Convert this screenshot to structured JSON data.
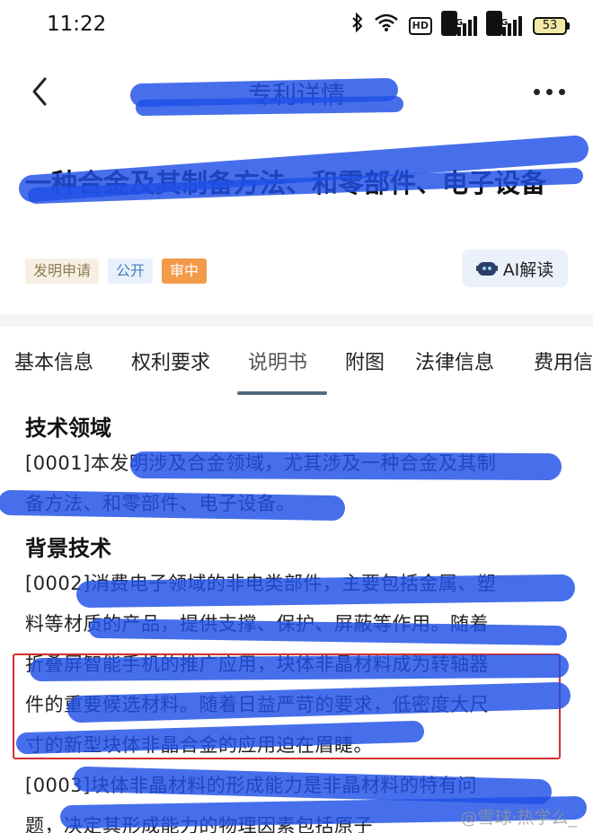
{
  "status_bar": {
    "time": "11:22",
    "network_1": "5G",
    "network_2": "4G",
    "hd": "HD",
    "battery": "53",
    "signal_levels": [
      4,
      4
    ]
  },
  "header": {
    "title": "专利详情"
  },
  "patent": {
    "title": "一种合金及其制备方法、和零部件、电子设备",
    "tags": [
      "发明申请",
      "公开",
      "审中"
    ],
    "ai_label": "AI解读"
  },
  "tabs": [
    "基本信息",
    "权利要求",
    "说明书",
    "附图",
    "法律信息",
    "费用信"
  ],
  "active_tab": 2,
  "content": {
    "heading_1": "技术领域",
    "para_1_lines": [
      "[0001]本发明涉及合金领域，尤其涉及一种合金及其制",
      "备方法、和零部件、电子设备。"
    ],
    "heading_2": "背景技术",
    "para_2_lines": [
      "[0002]消费电子领域的非电类部件，主要包括金属、塑",
      "料等材质的产品，提供支撑、保护、屏蔽等作用。随着",
      "折叠屏智能手机的推广应用，块体非晶材料成为转轴器",
      "件的重要候选材料。随着日益严苛的要求，低密度大尺",
      "寸的新型块体非晶合金的应用迫在眉睫。",
      "[0003]块体非晶材料的形成能力是非晶材料的特有问",
      "题，决定其形成能力的物理因素包括原子"
    ]
  },
  "watermark": "@雪球·热学么_",
  "colors": {
    "marker": "#1f4fe6",
    "red_box": "#d1312f",
    "tag_status": "#f39a4a"
  }
}
